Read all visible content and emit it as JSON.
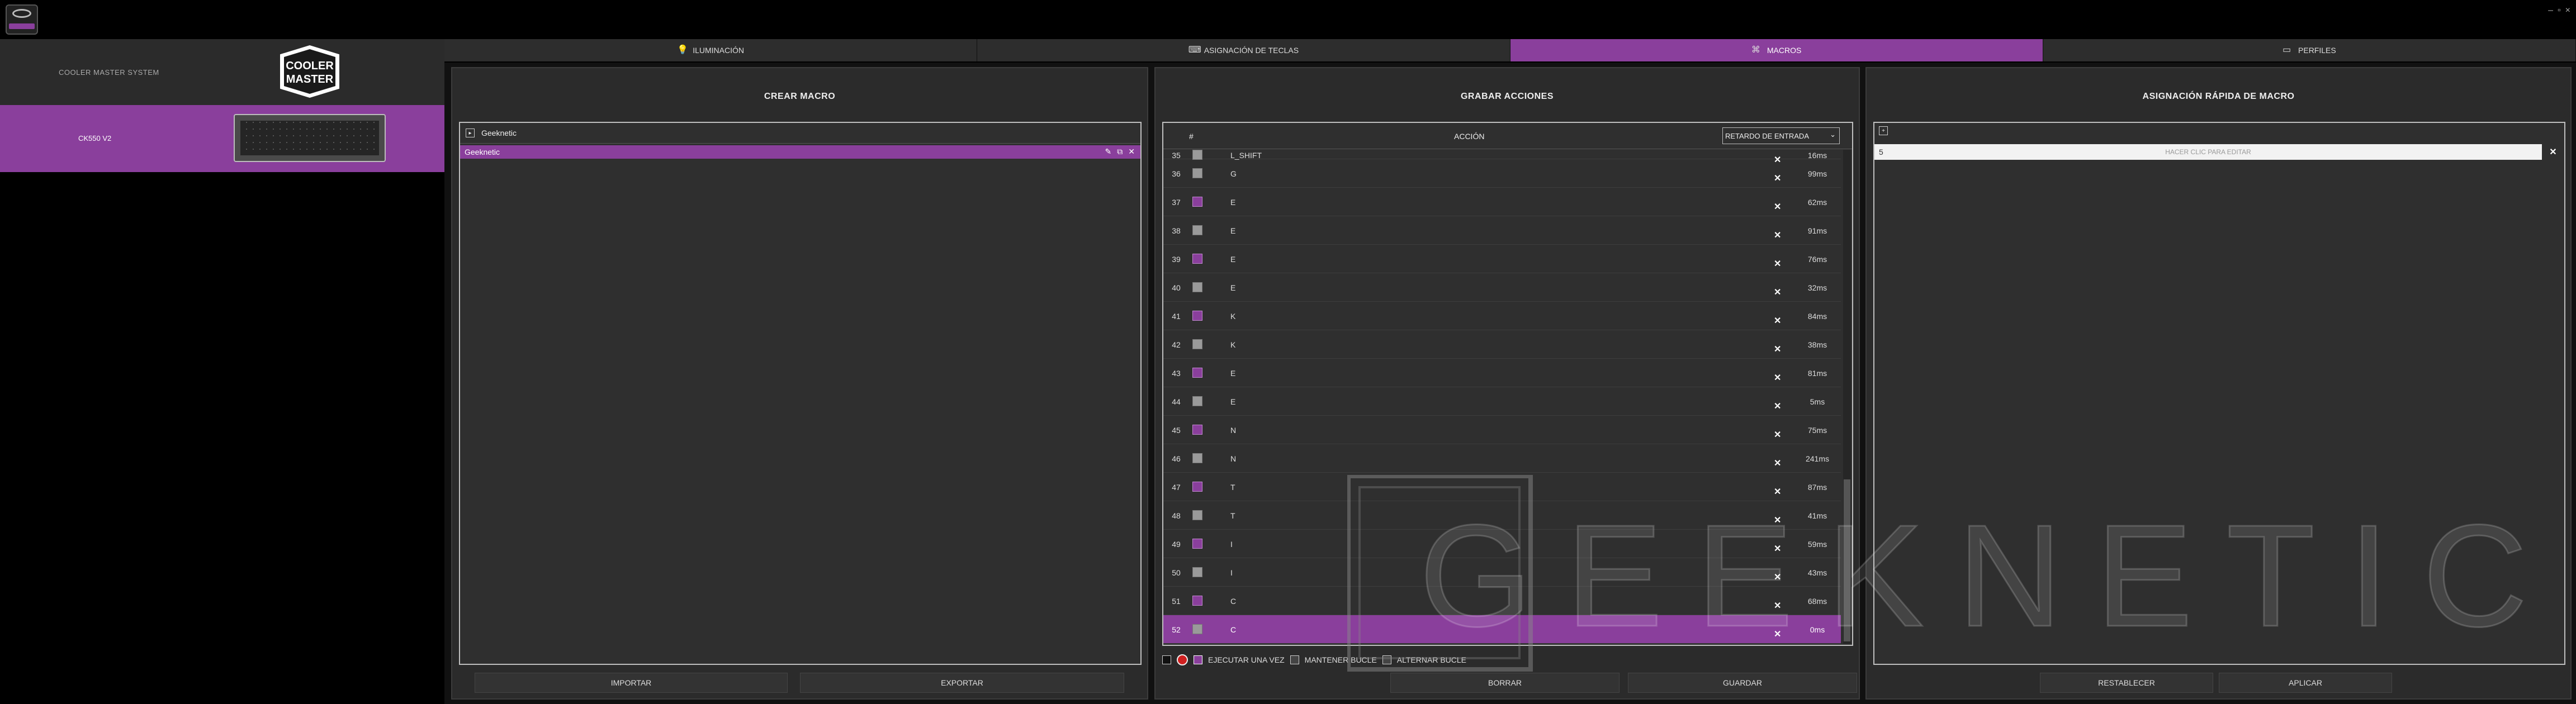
{
  "brand": {
    "system_label": "COOLER MASTER SYSTEM",
    "logo_line1": "COOLER",
    "logo_line2": "MASTER"
  },
  "device": {
    "name": "CK550 V2"
  },
  "tabs": [
    {
      "label": "ILUMINACIÓN",
      "icon": "bulb-icon",
      "active": false
    },
    {
      "label": "ASIGNACIÓN DE TECLAS",
      "icon": "keyboard-icon",
      "active": false
    },
    {
      "label": "MACROS",
      "icon": "macro-icon",
      "active": true
    },
    {
      "label": "PERFILES",
      "icon": "profile-icon",
      "active": false
    }
  ],
  "crear": {
    "title": "CREAR MACRO",
    "group_label": "Geeknetic",
    "selected_macro": "Geeknetic",
    "import_label": "IMPORTAR",
    "export_label": "EXPORTAR"
  },
  "grabar": {
    "title": "GRABAR ACCIONES",
    "col_num": "#",
    "col_action": "ACCIÓN",
    "col_delay": "RETARDO DE ENTRADA",
    "rows": [
      {
        "n": "35",
        "type": "down",
        "key": "L_SHIFT",
        "ms": "16ms"
      },
      {
        "n": "36",
        "type": "down",
        "key": "G",
        "ms": "99ms"
      },
      {
        "n": "37",
        "type": "up",
        "key": "E",
        "ms": "62ms"
      },
      {
        "n": "38",
        "type": "down",
        "key": "E",
        "ms": "91ms"
      },
      {
        "n": "39",
        "type": "up",
        "key": "E",
        "ms": "76ms"
      },
      {
        "n": "40",
        "type": "down",
        "key": "E",
        "ms": "32ms"
      },
      {
        "n": "41",
        "type": "up",
        "key": "K",
        "ms": "84ms"
      },
      {
        "n": "42",
        "type": "down",
        "key": "K",
        "ms": "38ms"
      },
      {
        "n": "43",
        "type": "up",
        "key": "E",
        "ms": "81ms"
      },
      {
        "n": "44",
        "type": "down",
        "key": "E",
        "ms": "5ms"
      },
      {
        "n": "45",
        "type": "up",
        "key": "N",
        "ms": "75ms"
      },
      {
        "n": "46",
        "type": "down",
        "key": "N",
        "ms": "241ms"
      },
      {
        "n": "47",
        "type": "up",
        "key": "T",
        "ms": "87ms"
      },
      {
        "n": "48",
        "type": "down",
        "key": "T",
        "ms": "41ms"
      },
      {
        "n": "49",
        "type": "up",
        "key": "I",
        "ms": "59ms"
      },
      {
        "n": "50",
        "type": "down",
        "key": "I",
        "ms": "43ms"
      },
      {
        "n": "51",
        "type": "up",
        "key": "C",
        "ms": "68ms"
      },
      {
        "n": "52",
        "type": "down",
        "key": "C",
        "ms": "0ms",
        "selected": true
      }
    ],
    "opt_once": "EJECUTAR UNA VEZ",
    "opt_hold": "MANTENER BUCLE",
    "opt_toggle": "ALTERNAR BUCLE",
    "delete_label": "BORRAR",
    "save_label": "GUARDAR"
  },
  "rapida": {
    "title": "ASIGNACIÓN RÁPIDA DE MACRO",
    "input_value": "5",
    "input_placeholder": "HACER CLIC PARA EDITAR",
    "reset_label": "RESTABLECER",
    "apply_label": "APLICAR"
  },
  "watermark": {
    "text": "GEEKNETIC"
  },
  "colors": {
    "accent": "#8a3f9c",
    "panel": "#2b2b2b",
    "background": "#000000"
  }
}
